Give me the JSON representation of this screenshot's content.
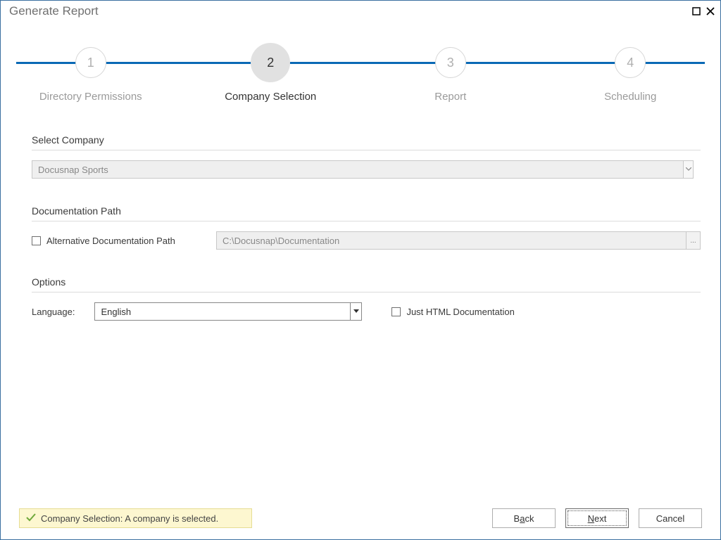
{
  "window": {
    "title": "Generate Report"
  },
  "steps": [
    {
      "num": "1",
      "label": "Directory Permissions"
    },
    {
      "num": "2",
      "label": "Company Selection"
    },
    {
      "num": "3",
      "label": "Report"
    },
    {
      "num": "4",
      "label": "Scheduling"
    }
  ],
  "sections": {
    "select_company": "Select Company",
    "documentation_path": "Documentation Path",
    "options": "Options"
  },
  "company_dropdown": {
    "selected": "Docusnap Sports"
  },
  "doc_path": {
    "alt_label": "Alternative Documentation Path",
    "value": "C:\\Docusnap\\Documentation"
  },
  "options": {
    "language_label": "Language:",
    "language_value": "English",
    "just_html_label": "Just HTML Documentation"
  },
  "status": {
    "text": "Company Selection: A company is selected."
  },
  "buttons": {
    "back_prefix": "B",
    "back_accel": "a",
    "back_suffix": "ck",
    "next_prefix": "",
    "next_accel": "N",
    "next_suffix": "ext",
    "cancel": "Cancel"
  }
}
